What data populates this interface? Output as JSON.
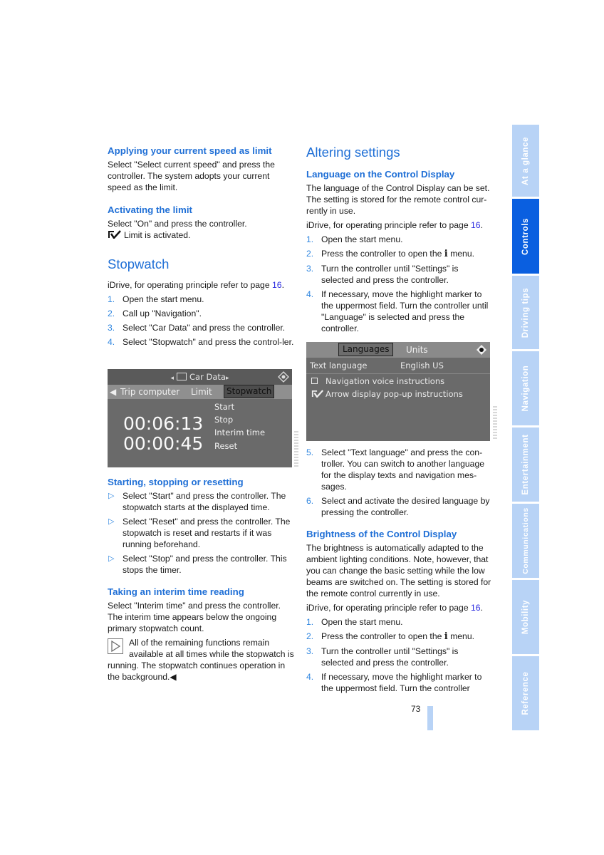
{
  "left": {
    "speed_limit": {
      "heading": "Applying your current speed as limit",
      "body": "Select \"Select current speed\" and press the controller. The system adopts your current speed as the limit."
    },
    "activating": {
      "heading": "Activating the limit",
      "body": "Select \"On\" and press the controller.",
      "status": "Limit is activated."
    },
    "stopwatch": {
      "heading": "Stopwatch",
      "intro_text": "iDrive, for operating principle refer to page ",
      "intro_page": "16",
      "intro_end": ".",
      "steps": [
        {
          "num": "1.",
          "text": "Open the start menu."
        },
        {
          "num": "2.",
          "text": "Call up \"Navigation\"."
        },
        {
          "num": "3.",
          "text": "Select \"Car Data\" and press the controller."
        },
        {
          "num": "4.",
          "text": "Select \"Stopwatch\" and press the control-ler."
        }
      ]
    },
    "screen": {
      "title": "Car Data",
      "tabs": [
        "Trip computer",
        "Limit",
        "Stopwatch"
      ],
      "selected_tab": "Stopwatch",
      "time_primary": "00:06:13",
      "time_interim": "00:00:45",
      "menu": [
        "Start",
        "Stop",
        "Interim time",
        "Reset"
      ]
    },
    "starting": {
      "heading": "Starting, stopping or resetting",
      "bullets": [
        "Select \"Start\" and press the controller. The stopwatch starts at the displayed time.",
        "Select \"Reset\" and press the controller. The stopwatch is reset and restarts if it was running beforehand.",
        "Select \"Stop\" and press the controller. This stops the timer."
      ]
    },
    "interim": {
      "heading": "Taking an interim time reading",
      "body": "Select \"Interim time\" and press the controller. The interim time appears below the ongoing primary stopwatch count.",
      "note": "All of the remaining functions remain available at all times while the stopwatch is running. The stopwatch continues operation in the background.",
      "note_end": "◀"
    }
  },
  "right": {
    "heading": "Altering settings",
    "language": {
      "heading": "Language on the Control Display",
      "body": "The language of the Control Display can be set. The setting is stored for the remote control cur-rently in use.",
      "intro_text": "iDrive, for operating principle refer to page ",
      "intro_page": "16",
      "intro_end": ".",
      "steps": [
        {
          "num": "1.",
          "text": "Open the start menu."
        },
        {
          "num": "2.",
          "pre": "Press the controller to open the ",
          "icon": "i",
          "post": " menu."
        },
        {
          "num": "3.",
          "text": "Turn the controller until \"Settings\" is selected and press the controller."
        },
        {
          "num": "4.",
          "text": "If necessary, move the highlight marker to the uppermost field. Turn the controller until \"Language\" is selected and press the controller."
        }
      ],
      "steps_after": [
        {
          "num": "5.",
          "text": "Select \"Text language\" and press the con-troller. You can switch to another language for the display texts and navigation mes-sages."
        },
        {
          "num": "6.",
          "text": "Select and activate the desired language by pressing the controller."
        }
      ]
    },
    "screen": {
      "tabs": [
        "Languages",
        "Units"
      ],
      "selected_tab": "Languages",
      "field_label": "Text language",
      "field_value": "English US",
      "options": [
        {
          "label": "Navigation voice instructions",
          "checked": false
        },
        {
          "label": "Arrow display pop-up instructions",
          "checked": true
        }
      ]
    },
    "brightness": {
      "heading": "Brightness of the Control Display",
      "body": "The brightness is automatically adapted to the ambient lighting conditions. Note, however, that you can change the basic setting while the low beams are switched on. The setting is stored for the remote control currently in use.",
      "intro_text": "iDrive, for operating principle refer to page ",
      "intro_page": "16",
      "intro_end": ".",
      "steps": [
        {
          "num": "1.",
          "text": "Open the start menu."
        },
        {
          "num": "2.",
          "pre": "Press the controller to open the ",
          "icon": "i",
          "post": " menu."
        },
        {
          "num": "3.",
          "text": "Turn the controller until \"Settings\" is selected and press the controller."
        },
        {
          "num": "4.",
          "text": "If necessary, move the highlight marker to the uppermost field. Turn the controller"
        }
      ]
    }
  },
  "side_tabs": [
    {
      "label": "At a glance",
      "active": false
    },
    {
      "label": "Controls",
      "active": true
    },
    {
      "label": "Driving tips",
      "active": false
    },
    {
      "label": "Navigation",
      "active": false
    },
    {
      "label": "Entertainment",
      "active": false
    },
    {
      "label": "Communications",
      "active": false
    },
    {
      "label": "Mobility",
      "active": false
    },
    {
      "label": "Reference",
      "active": false
    }
  ],
  "page_number": "73",
  "colors": {
    "heading": "#1f6fd6",
    "accent": "#2f86e0",
    "tab_active": "#0a5fe0",
    "tab_inactive": "#b8d3f6"
  }
}
